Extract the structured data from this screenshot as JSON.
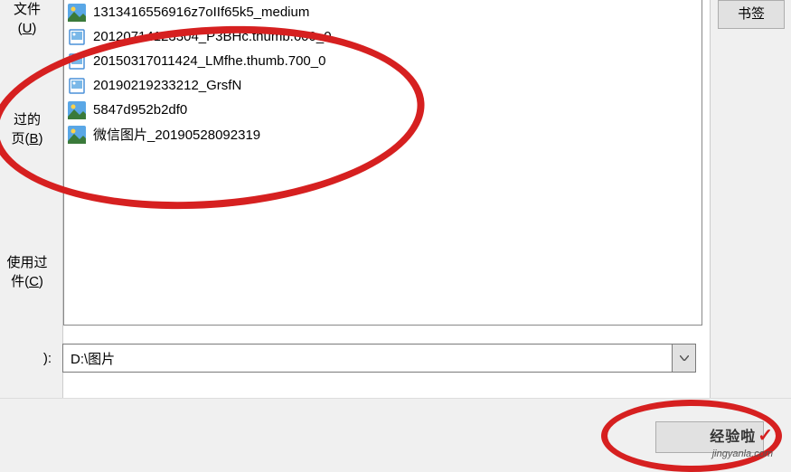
{
  "sidebar": {
    "label1_part1": "文件",
    "label1_part2": "U",
    "label2_part1": "过的",
    "label2_part2": "页(",
    "label2_part3": "B",
    "label2_part4": ")",
    "label3_part1": "使用过",
    "label3_part2": "件(",
    "label3_part3": "C",
    "label3_part4": ")"
  },
  "files": [
    {
      "name": "1313416556916z7oIIf65k5_medium",
      "icon": "image-large"
    },
    {
      "name": "20120714123304_P3BHc.thumb.600_0",
      "icon": "image-small"
    },
    {
      "name": "20150317011424_LMfhe.thumb.700_0",
      "icon": "image-small"
    },
    {
      "name": "20190219233212_GrsfN",
      "icon": "image-small"
    },
    {
      "name": "5847d952b2df0",
      "icon": "image-large"
    },
    {
      "name": "微信图片_20190528092319",
      "icon": "image-large"
    }
  ],
  "right": {
    "bookmark": "书签"
  },
  "path": {
    "label": "):",
    "value": "D:\\图片"
  },
  "watermark": {
    "text": "经验啦",
    "url": "jingyanla.com"
  }
}
